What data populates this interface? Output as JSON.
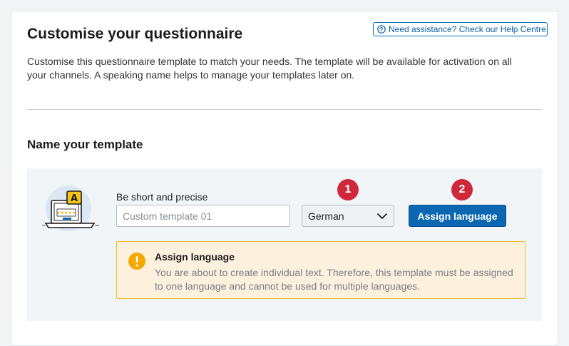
{
  "help": {
    "label": "Need assistance? Check our Help Centre.",
    "icon": "question-circle-icon"
  },
  "page": {
    "title": "Customise your questionnaire",
    "description": "Customise this questionnaire template to match your needs. The template will be available for activation on all your channels. A speaking name helps to manage your templates later on."
  },
  "section": {
    "title": "Name your template"
  },
  "form": {
    "label": "Be short and precise",
    "name_placeholder": "Custom template 01",
    "name_value": "",
    "language_selected": "German",
    "assign_button": "Assign language"
  },
  "steps": [
    "1",
    "2"
  ],
  "warning": {
    "title": "Assign language",
    "text": "You are about to create individual text. Therefore, this template must be assigned to one language and cannot be used for multiple languages."
  },
  "illustration": {
    "badge_letter": "A"
  },
  "colors": {
    "primary": "#0b67b2",
    "step_badge": "#d0283a",
    "warning_bg": "#fdf1de",
    "warning_border": "#efb92f",
    "warning_icon": "#f5a800"
  }
}
